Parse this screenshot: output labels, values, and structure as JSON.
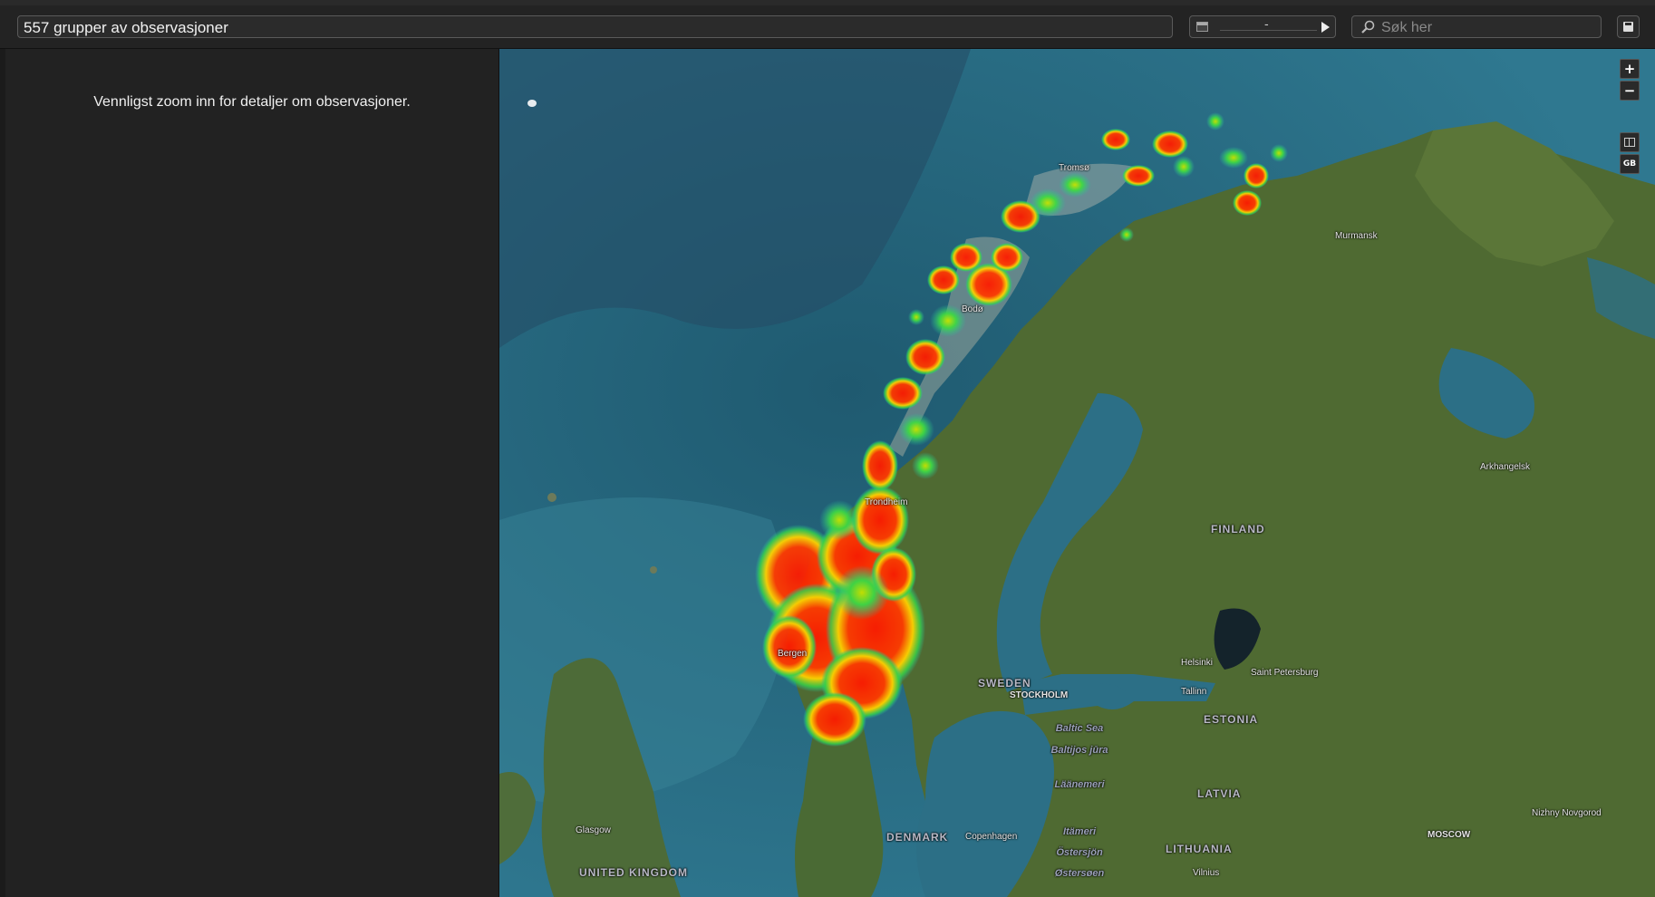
{
  "toolbar": {
    "group_count": "557 grupper av observasjoner",
    "date_separator": "-",
    "search_placeholder": "Søk her"
  },
  "sidebar": {
    "message": "Vennligst zoom inn for detaljer om observasjoner."
  },
  "map": {
    "controls": {
      "zoom_in": "+",
      "zoom_out": "−",
      "language": "GB"
    },
    "labels": {
      "tromso": "Tromsø",
      "bodo": "Bodø",
      "trondheim": "Trondheim",
      "bergen": "Bergen",
      "murmansk": "Murmansk",
      "arkhangelsk": "Arkhangelsk",
      "finland": "FINLAND",
      "sweden": "SWEDEN",
      "stockholm": "STOCKHOLM",
      "helsinki": "Helsinki",
      "saint_petersburg": "Saint Petersburg",
      "tallinn": "Tallinn",
      "estonia": "ESTONIA",
      "latvia": "LATVIA",
      "lithuania": "LITHUANIA",
      "denmark": "DENMARK",
      "copenhagen": "Copenhagen",
      "glasgow": "Glasgow",
      "united_kingdom": "UNITED KINGDOM",
      "vilnius": "Vilnius",
      "moscow": "MOSCOW",
      "nizhny": "Nizhny Novgorod",
      "baltic_sea": "Baltic Sea",
      "itameri": "Itämeri",
      "ostersjon": "Östersjön",
      "baltijos": "Baltijos jūra",
      "lanemeri": "Läänemeri",
      "ostersoen": "Østersøen"
    },
    "colors": {
      "heat_high": "#ff1a00",
      "heat_mid": "#ffe000",
      "heat_low": "#2cd84a",
      "ocean": "#2c6f86",
      "land": "#4f6a32"
    }
  }
}
